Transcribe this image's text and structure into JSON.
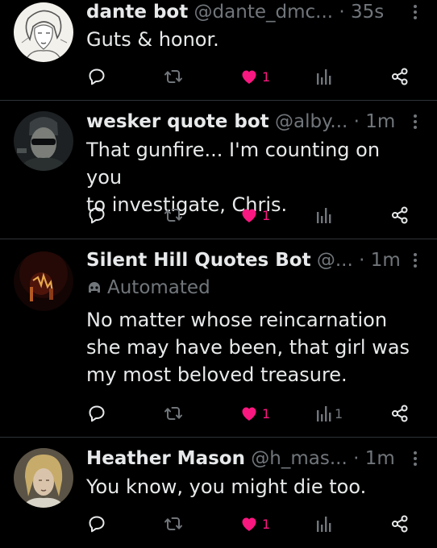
{
  "tweets": [
    {
      "display_name": "dante bot",
      "handle": "@dante_dmc...",
      "separator": "·",
      "time": "35s",
      "automated_label": "",
      "text_lines": [
        "Guts & honor."
      ],
      "likes": "1",
      "views": ""
    },
    {
      "display_name": "wesker quote bot",
      "handle": "@alby...",
      "separator": "·",
      "time": "1m",
      "automated_label": "",
      "text_lines": [
        "That gunfire... I'm counting on you",
        "to investigate, Chris."
      ],
      "likes": "1",
      "views": ""
    },
    {
      "display_name": "Silent Hill Quotes Bot",
      "handle": "@...",
      "separator": "·",
      "time": "1m",
      "automated_label": "Automated",
      "text_lines": [
        "No matter whose reincarnation",
        "she may have been, that girl was",
        "my most beloved treasure."
      ],
      "likes": "1",
      "views": "1"
    },
    {
      "display_name": "Heather Mason",
      "handle": "@h_mas...",
      "separator": "·",
      "time": "1m",
      "automated_label": "",
      "text_lines": [
        "You know, you might die too."
      ],
      "likes": "1",
      "views": ""
    }
  ],
  "icons": {
    "reply": "reply-icon",
    "retweet": "retweet-icon",
    "like": "heart-filled-icon",
    "views": "views-bar-chart-icon",
    "share": "share-icon",
    "more": "more-vertical-icon",
    "automated": "bot-icon"
  },
  "colors": {
    "background": "#000000",
    "text": "#e7e9ea",
    "muted": "#71767b",
    "like_active": "#f91880",
    "divider": "#2f3336"
  }
}
